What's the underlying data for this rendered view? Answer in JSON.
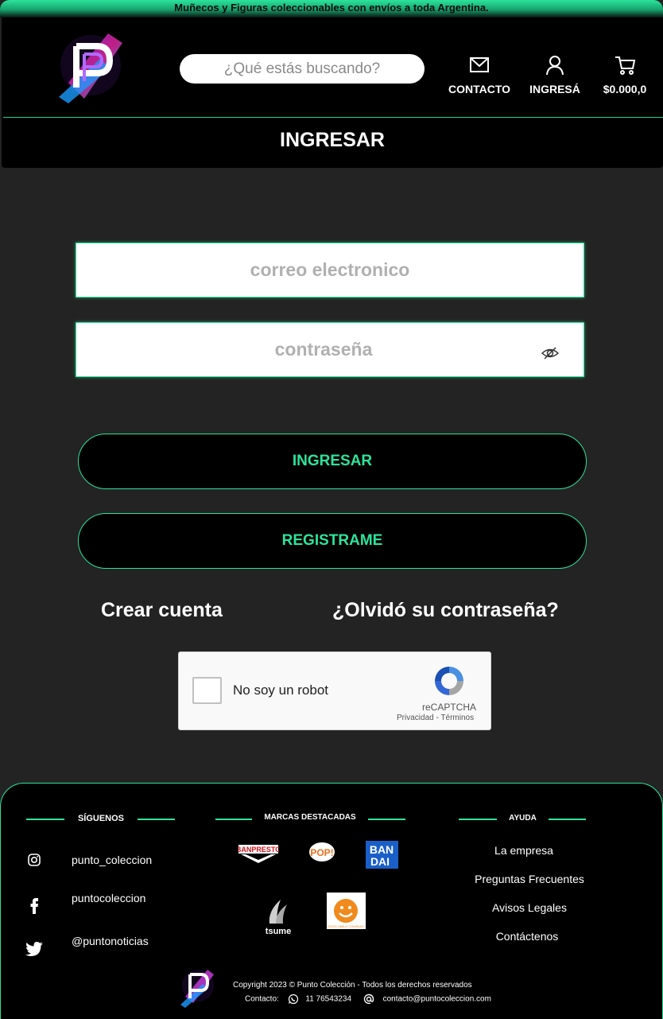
{
  "announcement": "Muñecos y Figuras coleccionables con envíos a toda Argentina.",
  "header": {
    "logo_text": "PUNTO COLECCION",
    "search_placeholder": "¿Qué estás buscando?",
    "nav": {
      "contact": "CONTACTO",
      "login": "INGRESÁ",
      "cart": "$0.000,0"
    },
    "page_title": "INGRESAR"
  },
  "form": {
    "email_placeholder": "correo electronico",
    "password_placeholder": "contraseña",
    "login_button": "INGRESAR",
    "register_button": "REGISTRAME",
    "create_account": "Crear cuenta",
    "forgot_password": "¿Olvidó su contraseña?"
  },
  "captcha": {
    "label": "No soy un robot",
    "brand": "reCAPTCHA",
    "links": "Privacidad - Términos"
  },
  "footer": {
    "follow_heading": "SÍGUENOS",
    "social": [
      {
        "icon": "instagram-icon",
        "handle": "punto_coleccion"
      },
      {
        "icon": "facebook-icon",
        "handle": "puntocoleccion"
      },
      {
        "icon": "twitter-icon",
        "handle": "@puntonoticias"
      }
    ],
    "brands_heading": "MARCAS DESTACADAS",
    "brands": {
      "banpresto": "BANPRESTO",
      "pop": "POP!",
      "bandai_top": "BAN",
      "bandai_bottom": "DAI",
      "tsume": "tsume",
      "goodsmile": "GOOD SMILE COMPANY"
    },
    "help_heading": "AYUDA",
    "help_links": [
      "La empresa",
      "Preguntas  Frecuentes",
      "Avisos Legales",
      "Contáctenos"
    ],
    "copyright": "Copyright 2023 © Punto Colección - Todos los derechos reservados",
    "contact_label": "Contacto:",
    "phone": "11 76543234",
    "email": "contacto@puntocoleccion.com"
  },
  "colors": {
    "accent": "#2de39b",
    "background": "#242323",
    "header": "#000000"
  }
}
